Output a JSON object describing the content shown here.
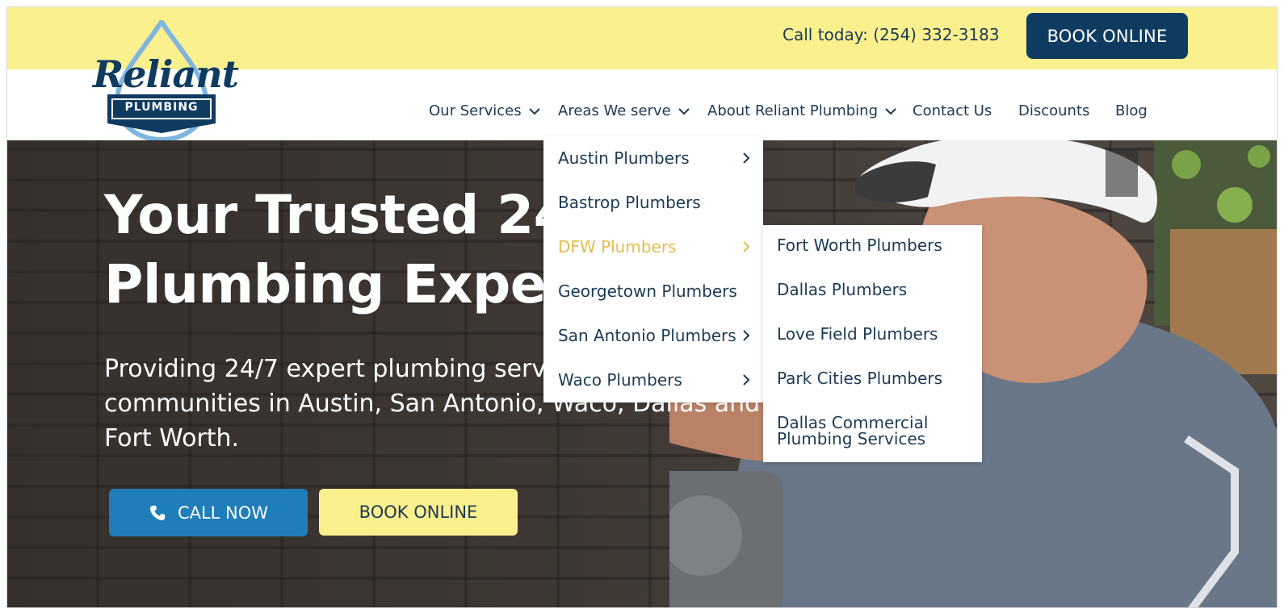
{
  "topbar": {
    "call_text": "Call today: (254) 332-3183",
    "book_label": "BOOK ONLINE"
  },
  "logo": {
    "word": "Reliant",
    "tag": "PLUMBING"
  },
  "nav": {
    "items": [
      {
        "label": "Our Services",
        "dropdown": true
      },
      {
        "label": "Areas We serve",
        "dropdown": true
      },
      {
        "label": "About Reliant Plumbing",
        "dropdown": true
      },
      {
        "label": "Contact Us",
        "dropdown": false
      },
      {
        "label": "Discounts",
        "dropdown": false
      },
      {
        "label": "Blog",
        "dropdown": false
      }
    ]
  },
  "hero": {
    "title_line1": "Your Trusted 24/7",
    "title_line2": "Plumbing Experts",
    "subtitle": "Providing 24/7 expert plumbing services for communities in Austin, San Antonio, Waco, Dallas and Fort Worth.",
    "call_label": "CALL NOW",
    "book_label": "BOOK ONLINE"
  },
  "areas_menu": {
    "items": [
      {
        "label": "Austin Plumbers",
        "submenu": true
      },
      {
        "label": "Bastrop Plumbers",
        "submenu": false
      },
      {
        "label": "DFW Plumbers",
        "submenu": true,
        "active": true
      },
      {
        "label": "Georgetown Plumbers",
        "submenu": false
      },
      {
        "label": "San Antonio Plumbers",
        "submenu": true
      },
      {
        "label": "Waco Plumbers",
        "submenu": true
      }
    ]
  },
  "dfw_menu": {
    "items": [
      "Fort Worth Plumbers",
      "Dallas Plumbers",
      "Love Field Plumbers",
      "Park Cities Plumbers",
      "Dallas Commercial Plumbing Services"
    ]
  },
  "colors": {
    "topbar": "#fbf08e",
    "navy": "#0f3b61",
    "text": "#1b3a55",
    "accent_blue": "#1f7dba",
    "active_gold": "#e7bc4f"
  }
}
